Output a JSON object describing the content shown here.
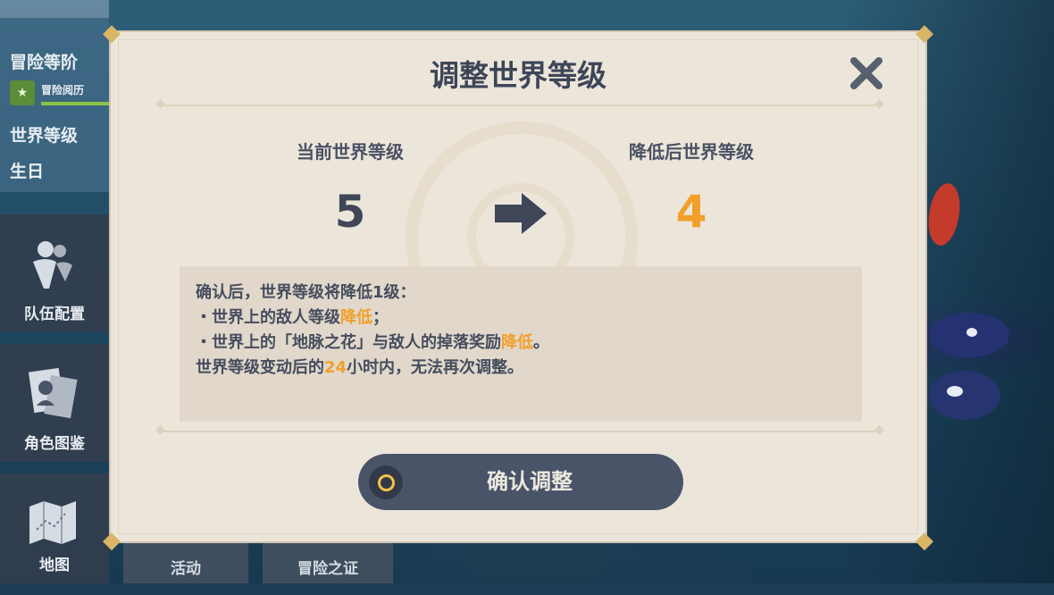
{
  "sidebar": {
    "adventure_rank_label": "冒险等阶",
    "adventure_exp_label": "冒险阅历",
    "world_level_label": "世界等级",
    "birthday_label": "生日",
    "nav": [
      {
        "label": "队伍配置",
        "icon": "party-icon"
      },
      {
        "label": "角色图鉴",
        "icon": "character-archive-icon"
      },
      {
        "label": "地图",
        "icon": "map-icon"
      }
    ],
    "bottom_tabs": [
      "活动",
      "冒险之证"
    ]
  },
  "dialog": {
    "title": "调整世界等级",
    "current_label": "当前世界等级",
    "current_level": "5",
    "after_label": "降低后世界等级",
    "after_level": "4",
    "info": {
      "line1": "确认后，世界等级将降低1级：",
      "line2_prefix": "・世界上的敌人等级",
      "line2_highlight": "降低",
      "line2_suffix": "；",
      "line3_prefix": "・世界上的「地脉之花」与敌人的掉落奖励",
      "line3_highlight": "降低",
      "line3_suffix": "。",
      "line4_prefix": "世界等级变动后的",
      "line4_highlight": "24",
      "line4_suffix": "小时内，无法再次调整。"
    },
    "confirm_label": "确认调整"
  },
  "colors": {
    "highlight": "#f1a02a",
    "current_level": "#3e4658",
    "button_bg": "#4a5468"
  }
}
